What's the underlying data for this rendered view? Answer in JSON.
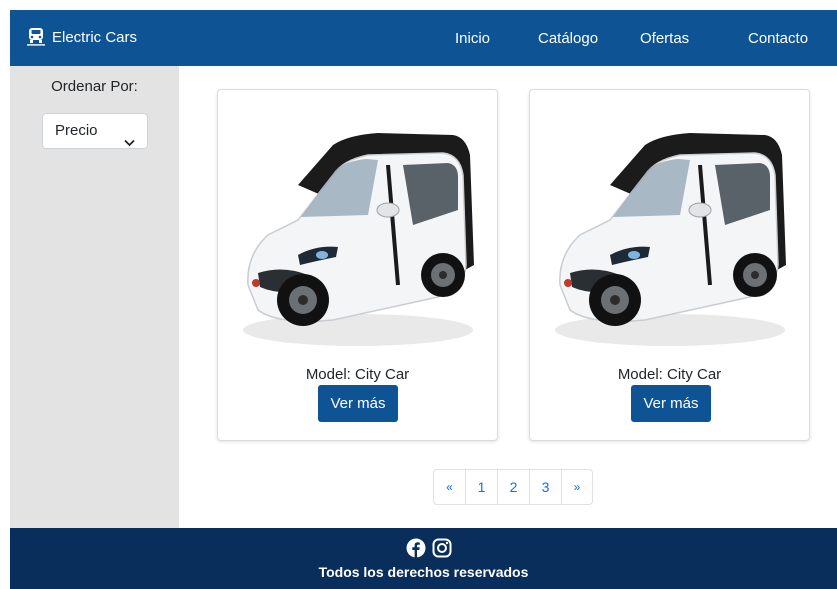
{
  "header": {
    "brand": "Electric Cars",
    "nav": [
      "Inicio",
      "Catálogo",
      "Ofertas",
      "Contacto"
    ]
  },
  "sidebar": {
    "sort_label": "Ordenar Por:",
    "sort_value": "Precio"
  },
  "products": [
    {
      "title": "Model: City Car",
      "button": "Ver más"
    },
    {
      "title": "Model: City Car",
      "button": "Ver más"
    }
  ],
  "pagination": {
    "prev": "«",
    "pages": [
      "1",
      "2",
      "3"
    ],
    "next": "»"
  },
  "footer": {
    "text": "Todos los derechos reservados",
    "icons": [
      "facebook-icon",
      "instagram-icon"
    ]
  },
  "colors": {
    "primary": "#0e5394",
    "footer": "#0a2e5c",
    "sidebar": "#e3e3e3",
    "link": "#0d6efd"
  }
}
